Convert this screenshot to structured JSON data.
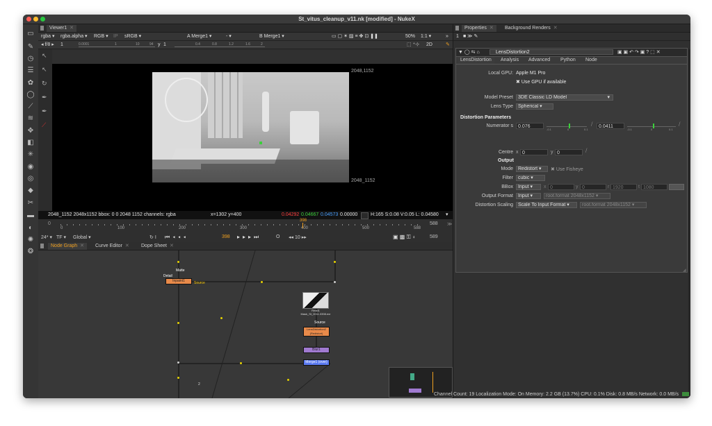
{
  "window": {
    "title": "St_vitus_cleanup_v11.nk [modified] - NukeX"
  },
  "colors": {
    "accent": "#f0a020",
    "red": "#ff4040",
    "green": "#3cd03c",
    "blue": "#4aa0ff",
    "node_orange": "#e88a4a",
    "node_purple": "#a07ad0",
    "node_blue": "#5a7af0",
    "gpu_green": "#3c8c3c"
  },
  "viewer": {
    "tab": "Viewer1",
    "row1": {
      "channels": "rgba",
      "alpha": "rgba.alpha",
      "display": "RGB",
      "ip": "IP",
      "lut": "sRGB",
      "a_label": "A",
      "a_input": "Merge1",
      "a_mode": "-",
      "b_label": "B",
      "b_input": "Merge1",
      "zoom": "50%",
      "ratio": "1:1"
    },
    "row2": {
      "fstop": "f/8",
      "frame_field": "1",
      "scale_start": "0.0001",
      "scale_labels": [
        "1",
        "10",
        "94"
      ],
      "y_label": "y",
      "y_value": "1",
      "y_scale": [
        "0.4",
        "0.8",
        "1.2",
        "1.6",
        "2"
      ],
      "mode": "2D"
    },
    "top_right_label": "2048,1152",
    "bottom_right_label": "2048_1152",
    "info": {
      "format": "2048_1152 2048x1152  bbox: 0 0 2048 1152 channels: rgba",
      "coords": "x=1302 y=400",
      "r": "0.04292",
      "g": "0.04667",
      "b": "0.04573",
      "a": "0.00000",
      "hsv": "H:165 S:0.08 V:0.05  L: 0.04580"
    }
  },
  "timeline": {
    "in": "0",
    "ticks": [
      "0",
      "100",
      "200",
      "300",
      "400",
      "500",
      "588"
    ],
    "current": "398",
    "end": "588",
    "end2": "589",
    "fps": "24*",
    "tf": "TF",
    "global": "Global",
    "frame": "398",
    "step": "10",
    "i_label": "I",
    "o_label": "O"
  },
  "nodegraph": {
    "tabs": [
      "Node Graph",
      "Curve Editor",
      "Dope Sheet"
    ],
    "nodes": {
      "inpaint": "Inpaint1",
      "matte": "Matte",
      "detail": "Detail",
      "source": "Source",
      "read_name": "Read1",
      "read_file": "Mask_St_0011.0398.exr",
      "read_source": "Source",
      "lens": "LensDistortion2",
      "lens_sub": "(Redistort)",
      "blur": "Blur1",
      "merge": "Merge1 (over)",
      "mini_label": "2"
    }
  },
  "props": {
    "tabs": [
      "Properties",
      "Background Renders"
    ],
    "count": "1",
    "node_name": "LensDistortion2",
    "subtabs": [
      "LensDistortion",
      "Analysis",
      "Advanced",
      "Python",
      "Node"
    ],
    "local_gpu_label": "Local GPU:",
    "local_gpu": "Apple M1 Pro",
    "use_gpu": "Use GPU if available",
    "model_preset_label": "Model Preset",
    "model_preset": "3DE Classic LD Model",
    "lens_type_label": "Lens Type",
    "lens_type": "Spherical",
    "dist_params": "Distortion Parameters",
    "numerator_label": "Numerator s",
    "num1": "0.076",
    "num2": "0.0411",
    "slider_ticks": [
      "-0.1",
      "0",
      "0.1"
    ],
    "centre_label": "Centre",
    "centre_x_label": "x",
    "centre_x": "0",
    "centre_y_label": "y",
    "centre_y": "0",
    "output": "Output",
    "mode_label": "Mode",
    "mode": "Redistort",
    "fisheye": "Use Fisheye",
    "filter_label": "Filter",
    "filter": "cubic",
    "bbox_label": "BBox",
    "bbox_mode": "Input",
    "bbox_x": "0",
    "bbox_y": "0",
    "bbox_r": "1920",
    "bbox_t": "1080",
    "bbox_xl": "x",
    "bbox_yl": "y",
    "bbox_rl": "r",
    "bbox_tl": "t",
    "output_format_label": "Output Format",
    "output_format": "Input",
    "output_format_val": "root.format 2048x1152",
    "dist_scaling_label": "Distortion Scaling",
    "dist_scaling": "Scale To Input Format",
    "dist_scaling_val": "root.format 2048x1152"
  },
  "status": {
    "text": "Channel Count: 19  Localization Mode: On  Memory: 2.2 GB (13.7%)  CPU: 0.1%  Disk: 0.8 MB/s  Network: 0.0 MB/s"
  }
}
